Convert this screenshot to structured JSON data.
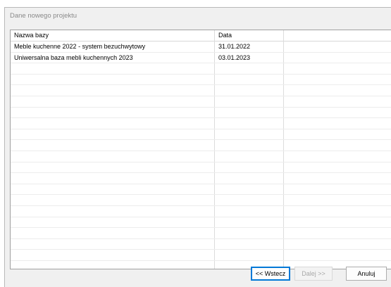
{
  "dialog": {
    "title": "Dane nowego projektu"
  },
  "table": {
    "columns": [
      "Nazwa bazy",
      "Data"
    ],
    "rows": [
      {
        "name": "Meble kuchenne 2022 - system bezuchwytowy",
        "date": "31.01.2022"
      },
      {
        "name": "Uniwersalna baza mebli kuchennych 2023",
        "date": "03.01.2023"
      }
    ]
  },
  "buttons": {
    "back": "<< Wstecz",
    "next": "Dalej >>",
    "cancel": "Anuluj"
  }
}
